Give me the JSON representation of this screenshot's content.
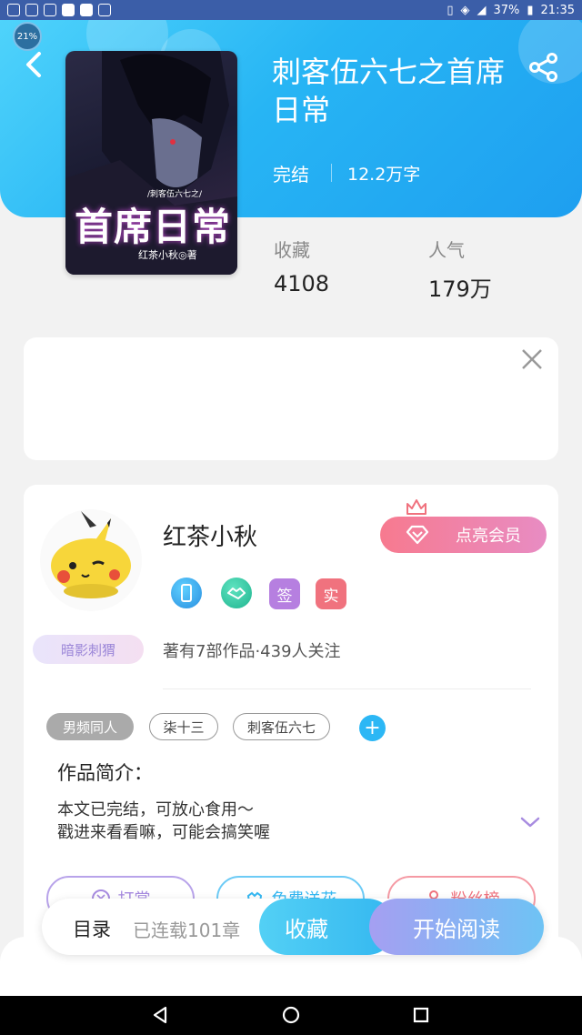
{
  "status_bar": {
    "battery": "37%",
    "time": "21:35"
  },
  "battery_badge": "21%",
  "book": {
    "title": "刺客伍六七之首席日常",
    "status": "完结",
    "word_count": "12.2万字",
    "cover": {
      "title": "首席日常",
      "subtitle": "/刺客伍六七之/",
      "author": "红茶小秋◎著"
    },
    "stats": [
      {
        "label": "收藏",
        "value": "4108"
      },
      {
        "label": "人气",
        "value": "179万"
      }
    ]
  },
  "author": {
    "name": "红茶小秋",
    "vip_button": "点亮会员",
    "badges": [
      {
        "type": "phone-icon",
        "color": "#2aa2e8"
      },
      {
        "type": "handshake-icon",
        "color": "#29c7a3"
      },
      {
        "type": "text",
        "label": "签",
        "color": "#b67fe0"
      },
      {
        "type": "text",
        "label": "实",
        "color": "#f0727e"
      }
    ],
    "fan_tag": "暗影刺猬",
    "stats_line": "著有7部作品·439人关注"
  },
  "tags": [
    "男频同人",
    "柒十三",
    "刺客伍六七"
  ],
  "intro": {
    "title": "作品简介：",
    "line1": "本文已完结，可放心食用～",
    "line2": "戳进来看看嘛，可能会搞笑喔"
  },
  "actions": [
    {
      "label": "打赏",
      "icon": "coin-icon",
      "color": "#a78be0"
    },
    {
      "label": "免费送花",
      "icon": "flower-icon",
      "color": "#35b8f2"
    },
    {
      "label": "粉丝榜",
      "icon": "user-icon",
      "color": "#f0727e"
    }
  ],
  "bottom_bar": {
    "toc": "目录",
    "chapters": "已连载101章",
    "collect": "收藏",
    "read": "开始阅读"
  }
}
